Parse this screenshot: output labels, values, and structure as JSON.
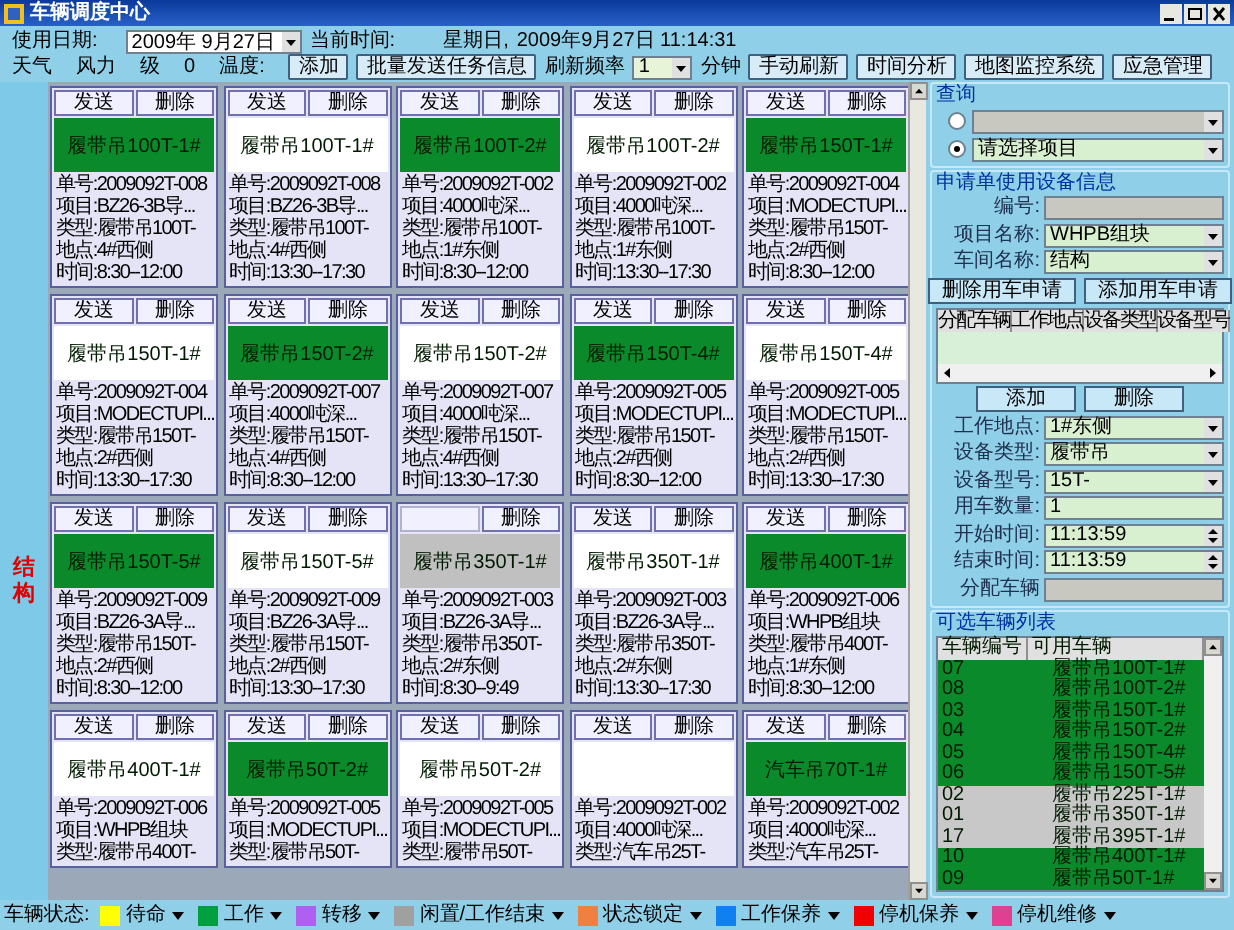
{
  "window": {
    "title": "车辆调度中心"
  },
  "toolbar": {
    "date_label": "使用日期:",
    "date_value": "2009年 9月27日",
    "time_label": "当前时间:",
    "weekday": "星期日,",
    "datetime": "2009年9月27日 11:14:31",
    "row2": [
      {
        "kind": "label",
        "text": "天气"
      },
      {
        "kind": "label",
        "text": "风力"
      },
      {
        "kind": "label",
        "text": "级"
      },
      {
        "kind": "label",
        "text": "0"
      },
      {
        "kind": "label",
        "text": "温度:"
      },
      {
        "kind": "button",
        "text": "添加"
      },
      {
        "kind": "button",
        "text": "批量发送任务信息"
      },
      {
        "kind": "label",
        "text": "刷新频率"
      },
      {
        "kind": "select",
        "text": "1"
      },
      {
        "kind": "label",
        "text": "分钟"
      },
      {
        "kind": "button",
        "text": "手动刷新"
      },
      {
        "kind": "button",
        "text": "时间分析"
      },
      {
        "kind": "button",
        "text": "地图监控系统"
      },
      {
        "kind": "button",
        "text": "应急管理"
      }
    ]
  },
  "department": "结构",
  "cards": [
    {
      "color": "#0a8a2a",
      "buttons": [
        {
          "kind": "send",
          "label": "发送"
        },
        {
          "kind": "delete",
          "label": "删除"
        }
      ],
      "name": "履带吊100T-1#",
      "info": [
        "单号:2009092T-008",
        "项目:BZ26-3B导...",
        "类型:履带吊100T-",
        "地点:4#西侧",
        "时间:8:30--12:00"
      ]
    },
    {
      "color": "#ffffff",
      "buttons": [
        {
          "kind": "send",
          "label": "发送"
        },
        {
          "kind": "delete",
          "label": "删除"
        }
      ],
      "name": "履带吊100T-1#",
      "info": [
        "单号:2009092T-008",
        "项目:BZ26-3B导...",
        "类型:履带吊100T-",
        "地点:4#西侧",
        "时间:13:30--17:30"
      ]
    },
    {
      "color": "#0a8a2a",
      "buttons": [
        {
          "kind": "send",
          "label": "发送"
        },
        {
          "kind": "delete",
          "label": "删除"
        }
      ],
      "name": "履带吊100T-2#",
      "info": [
        "单号:2009092T-002",
        "项目:4000吨深...",
        "类型:履带吊100T-",
        "地点:1#东侧",
        "时间:8:30--12:00"
      ]
    },
    {
      "color": "#ffffff",
      "buttons": [
        {
          "kind": "send",
          "label": "发送"
        },
        {
          "kind": "delete",
          "label": "删除"
        }
      ],
      "name": "履带吊100T-2#",
      "info": [
        "单号:2009092T-002",
        "项目:4000吨深...",
        "类型:履带吊100T-",
        "地点:1#东侧",
        "时间:13:30--17:30"
      ]
    },
    {
      "color": "#0a8a2a",
      "buttons": [
        {
          "kind": "send",
          "label": "发送"
        },
        {
          "kind": "delete",
          "label": "删除"
        }
      ],
      "name": "履带吊150T-1#",
      "info": [
        "单号:2009092T-004",
        "项目:MODECTUPI...",
        "类型:履带吊150T-",
        "地点:2#西侧",
        "时间:8:30--12:00"
      ]
    },
    {
      "color": "#ffffff",
      "buttons": [
        {
          "kind": "send",
          "label": "发送"
        },
        {
          "kind": "delete",
          "label": "删除"
        }
      ],
      "name": "履带吊150T-1#",
      "info": [
        "单号:2009092T-004",
        "项目:MODECTUPI...",
        "类型:履带吊150T-",
        "地点:2#西侧",
        "时间:13:30--17:30"
      ]
    },
    {
      "color": "#0a8a2a",
      "buttons": [
        {
          "kind": "send",
          "label": "发送"
        },
        {
          "kind": "delete",
          "label": "删除"
        }
      ],
      "name": "履带吊150T-2#",
      "info": [
        "单号:2009092T-007",
        "项目:4000吨深...",
        "类型:履带吊150T-",
        "地点:4#西侧",
        "时间:8:30--12:00"
      ]
    },
    {
      "color": "#ffffff",
      "buttons": [
        {
          "kind": "send",
          "label": "发送"
        },
        {
          "kind": "delete",
          "label": "删除"
        }
      ],
      "name": "履带吊150T-2#",
      "info": [
        "单号:2009092T-007",
        "项目:4000吨深...",
        "类型:履带吊150T-",
        "地点:4#西侧",
        "时间:13:30--17:30"
      ]
    },
    {
      "color": "#0a8a2a",
      "buttons": [
        {
          "kind": "send",
          "label": "发送"
        },
        {
          "kind": "delete",
          "label": "删除"
        }
      ],
      "name": "履带吊150T-4#",
      "info": [
        "单号:2009092T-005",
        "项目:MODECTUPI...",
        "类型:履带吊150T-",
        "地点:2#西侧",
        "时间:8:30--12:00"
      ]
    },
    {
      "color": "#ffffff",
      "buttons": [
        {
          "kind": "send",
          "label": "发送"
        },
        {
          "kind": "delete",
          "label": "删除"
        }
      ],
      "name": "履带吊150T-4#",
      "info": [
        "单号:2009092T-005",
        "项目:MODECTUPI...",
        "类型:履带吊150T-",
        "地点:2#西侧",
        "时间:13:30--17:30"
      ]
    },
    {
      "color": "#0a8a2a",
      "buttons": [
        {
          "kind": "send",
          "label": "发送"
        },
        {
          "kind": "delete",
          "label": "删除"
        }
      ],
      "name": "履带吊150T-5#",
      "info": [
        "单号:2009092T-009",
        "项目:BZ26-3A导...",
        "类型:履带吊150T-",
        "地点:2#西侧",
        "时间:8:30--12:00"
      ]
    },
    {
      "color": "#ffffff",
      "buttons": [
        {
          "kind": "send",
          "label": "发送"
        },
        {
          "kind": "delete",
          "label": "删除"
        }
      ],
      "name": "履带吊150T-5#",
      "info": [
        "单号:2009092T-009",
        "项目:BZ26-3A导...",
        "类型:履带吊150T-",
        "地点:2#西侧",
        "时间:13:30--17:30"
      ]
    },
    {
      "color": "#c0c0c0",
      "buttons": [
        {
          "kind": "delete",
          "label": "删除"
        }
      ],
      "name": "履带吊350T-1#",
      "info": [
        "单号:2009092T-003",
        "项目:BZ26-3A导...",
        "类型:履带吊350T-",
        "地点:2#东侧",
        "时间:8:30--9:49"
      ]
    },
    {
      "color": "#ffffff",
      "buttons": [
        {
          "kind": "send",
          "label": "发送"
        },
        {
          "kind": "delete",
          "label": "删除"
        }
      ],
      "name": "履带吊350T-1#",
      "info": [
        "单号:2009092T-003",
        "项目:BZ26-3A导...",
        "类型:履带吊350T-",
        "地点:2#东侧",
        "时间:13:30--17:30"
      ]
    },
    {
      "color": "#0a8a2a",
      "buttons": [
        {
          "kind": "send",
          "label": "发送"
        },
        {
          "kind": "delete",
          "label": "删除"
        }
      ],
      "name": "履带吊400T-1#",
      "info": [
        "单号:2009092T-006",
        "项目:WHPB组块",
        "类型:履带吊400T-",
        "地点:1#东侧",
        "时间:8:30--12:00"
      ]
    },
    {
      "color": "#ffffff",
      "buttons": [
        {
          "kind": "send",
          "label": "发送"
        },
        {
          "kind": "delete",
          "label": "删除"
        }
      ],
      "name": "履带吊400T-1#",
      "info": [
        "单号:2009092T-006",
        "项目:WHPB组块",
        "类型:履带吊400T-"
      ]
    },
    {
      "color": "#0a8a2a",
      "buttons": [
        {
          "kind": "send",
          "label": "发送"
        },
        {
          "kind": "delete",
          "label": "删除"
        }
      ],
      "name": "履带吊50T-2#",
      "info": [
        "单号:2009092T-005",
        "项目:MODECTUPI...",
        "类型:履带吊50T-"
      ]
    },
    {
      "color": "#ffffff",
      "buttons": [
        {
          "kind": "send",
          "label": "发送"
        },
        {
          "kind": "delete",
          "label": "删除"
        }
      ],
      "name": "履带吊50T-2#",
      "info": [
        "单号:2009092T-005",
        "项目:MODECTUPI...",
        "类型:履带吊50T-"
      ]
    },
    {
      "color": "#ffffff",
      "buttons": [
        {
          "kind": "send",
          "label": "发送"
        },
        {
          "kind": "delete",
          "label": "删除"
        }
      ],
      "info": [
        "单号:2009092T-002",
        "项目:4000吨深...",
        "类型:汽车吊25T-"
      ]
    },
    {
      "color": "#0a8a2a",
      "buttons": [
        {
          "kind": "send",
          "label": "发送"
        },
        {
          "kind": "delete",
          "label": "删除"
        }
      ],
      "name": "汽车吊70T-1#",
      "info": [
        "单号:2009092T-002",
        "项目:4000吨深...",
        "类型:汽车吊25T-"
      ]
    }
  ],
  "query": {
    "title": "查询",
    "options": [
      {
        "selected": false
      },
      {
        "selected": true,
        "value": "请选择项目"
      }
    ]
  },
  "application": {
    "title": "申请单使用设备信息",
    "fields": [
      {
        "label": "编号:",
        "kind": "text",
        "disabled": true
      },
      {
        "label": "项目名称:",
        "kind": "combo",
        "value": "WHPB组块",
        "disabled": false
      },
      {
        "label": "车间名称:",
        "kind": "combo",
        "value": "结构",
        "disabled": false
      }
    ],
    "buttons": [
      "删除用车申请",
      "添加用车申请"
    ],
    "table_columns": [
      "分配车辆",
      "工作地点",
      "设备类型",
      "设备型号"
    ],
    "buttons2": [
      "添加",
      "删除"
    ],
    "fields2": [
      {
        "label": "工作地点:",
        "kind": "combo",
        "value": "1#东侧",
        "disabled": false
      },
      {
        "label": "设备类型:",
        "kind": "combo",
        "value": "履带吊",
        "disabled": false
      },
      {
        "label": "设备型号:",
        "kind": "combo",
        "value": "15T-",
        "disabled": false
      },
      {
        "label": "用车数量:",
        "kind": "text",
        "value": "1",
        "disabled": false
      },
      {
        "label": "开始时间:",
        "kind": "spin",
        "value": "11:13:59",
        "disabled": false
      },
      {
        "label": "结束时间:",
        "kind": "spin",
        "value": "11:13:59",
        "disabled": false
      },
      {
        "label": "分配车辆",
        "kind": "text",
        "disabled": true
      }
    ]
  },
  "vehicle_list": {
    "title": "可选车辆列表",
    "columns": [
      "车辆编号",
      "可用车辆"
    ],
    "rows": [
      {
        "id": "07",
        "name": "履带吊100T-1#",
        "color": "#0a8a2a"
      },
      {
        "id": "08",
        "name": "履带吊100T-2#",
        "color": "#0a8a2a"
      },
      {
        "id": "03",
        "name": "履带吊150T-1#",
        "color": "#0a8a2a"
      },
      {
        "id": "04",
        "name": "履带吊150T-2#",
        "color": "#0a8a2a"
      },
      {
        "id": "05",
        "name": "履带吊150T-4#",
        "color": "#0a8a2a"
      },
      {
        "id": "06",
        "name": "履带吊150T-5#",
        "color": "#0a8a2a"
      },
      {
        "id": "02",
        "name": "履带吊225T-1#",
        "color": "#c8c8c8"
      },
      {
        "id": "01",
        "name": "履带吊350T-1#",
        "color": "#c8c8c8"
      },
      {
        "id": "17",
        "name": "履带吊395T-1#",
        "color": "#c8c8c8"
      },
      {
        "id": "10",
        "name": "履带吊400T-1#",
        "color": "#0a8a2a"
      },
      {
        "id": "09",
        "name": "履带吊50T-1#",
        "color": "#0a8a2a"
      }
    ]
  },
  "status_legend": {
    "label": "车辆状态:",
    "items": [
      {
        "label": "待命",
        "color": "#ffff00"
      },
      {
        "label": "工作",
        "color": "#00a040"
      },
      {
        "label": "转移",
        "color": "#b060f0"
      },
      {
        "label": "闲置/工作结束",
        "color": "#a0a0a0"
      },
      {
        "label": "状态锁定",
        "color": "#f08040"
      },
      {
        "label": "工作保养",
        "color": "#1080f0"
      },
      {
        "label": "停机保养",
        "color": "#f00000"
      },
      {
        "label": "停机维修",
        "color": "#e04090"
      }
    ]
  }
}
